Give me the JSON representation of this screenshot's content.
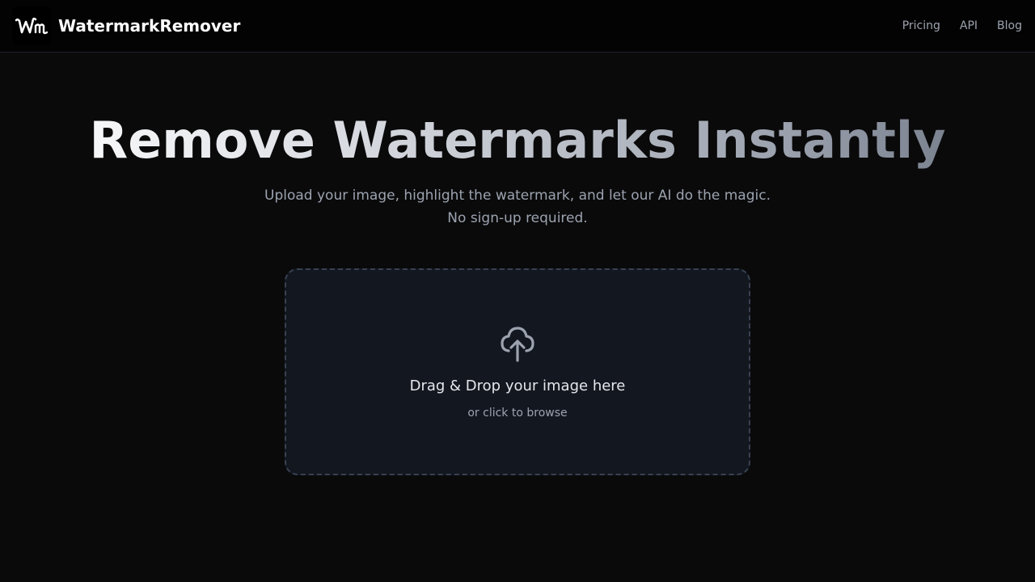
{
  "header": {
    "logo_text": "Wm",
    "brand": "WatermarkRemover",
    "nav": [
      {
        "label": "Pricing"
      },
      {
        "label": "API"
      },
      {
        "label": "Blog"
      }
    ]
  },
  "hero": {
    "title": "Remove Watermarks Instantly",
    "subtitle_line1": "Upload your image, highlight the watermark, and let our AI do the magic.",
    "subtitle_line2": "No sign-up required."
  },
  "dropzone": {
    "icon": "cloud-upload-icon",
    "title": "Drag & Drop your image here",
    "subtitle": "or click to browse"
  },
  "colors": {
    "background": "#0a0a0b",
    "header_bg": "#030303",
    "dropzone_bg": "#131720",
    "muted_text": "#9ca3af"
  }
}
